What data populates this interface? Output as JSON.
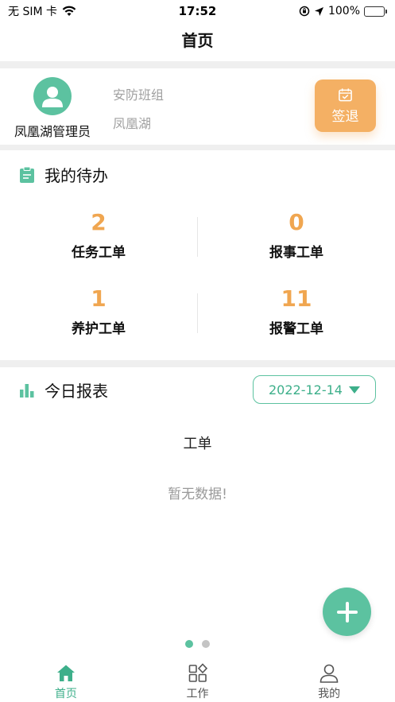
{
  "status_bar": {
    "carrier": "无 SIM 卡",
    "time": "17:52",
    "battery": "100%"
  },
  "header": {
    "title": "首页"
  },
  "profile": {
    "name": "凤凰湖管理员",
    "team": "安防班组",
    "area": "凤凰湖",
    "checkout_label": "签退"
  },
  "todo": {
    "title": "我的待办",
    "items": [
      {
        "count": "2",
        "label": "任务工单"
      },
      {
        "count": "0",
        "label": "报事工单"
      },
      {
        "count": "1",
        "label": "养护工单"
      },
      {
        "count": "11",
        "label": "报警工单"
      }
    ]
  },
  "report": {
    "title": "今日报表",
    "date": "2022-12-14",
    "chart_title": "工单",
    "empty_text": "暂无数据!"
  },
  "pager": {
    "pages": 2,
    "active": 1
  },
  "tabbar": {
    "items": [
      {
        "label": "首页",
        "icon": "home-icon",
        "active": true
      },
      {
        "label": "工作",
        "icon": "apps-icon",
        "active": false
      },
      {
        "label": "我的",
        "icon": "user-icon",
        "active": false
      }
    ]
  },
  "colors": {
    "accent": "#5cc2a0",
    "accent_dark": "#3daf8a",
    "count": "#f0a650",
    "checkout": "#f4b064"
  }
}
